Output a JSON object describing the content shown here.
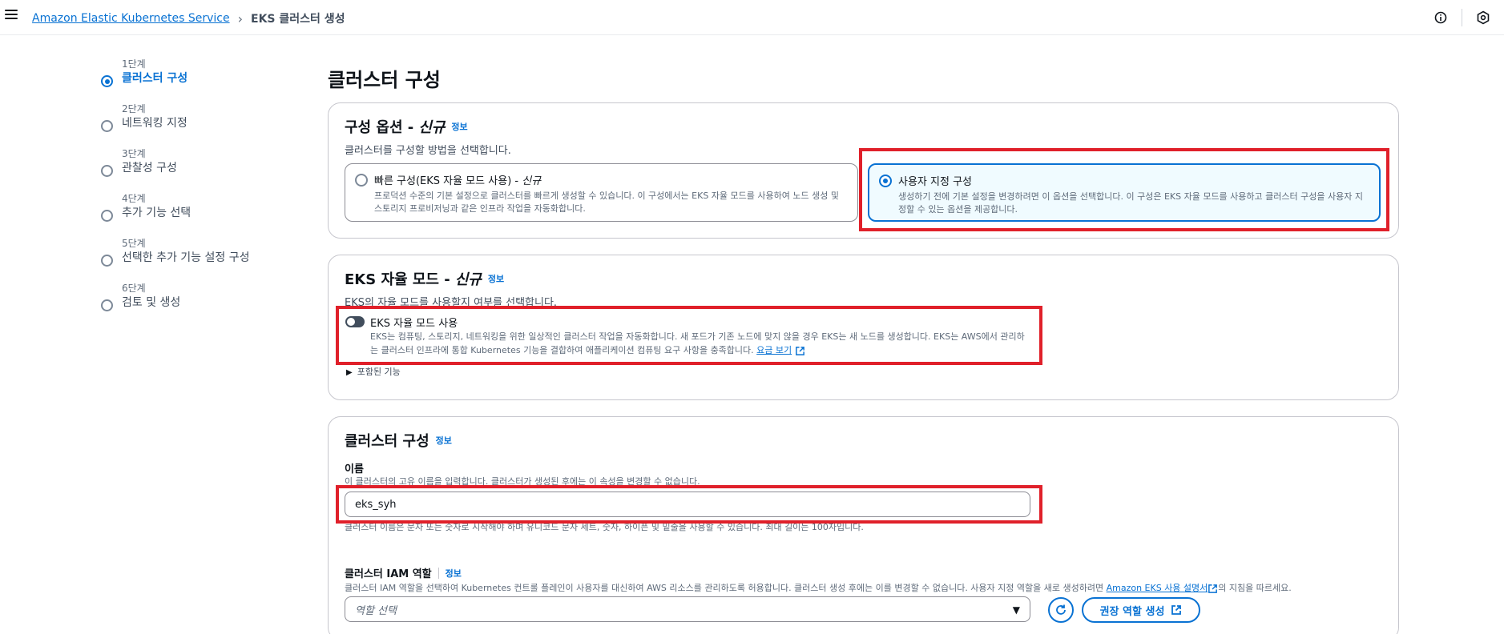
{
  "topbar": {
    "breadcrumb_service": "Amazon Elastic Kubernetes Service",
    "breadcrumb_current": "EKS 클러스터 생성"
  },
  "steps": [
    {
      "num": "1단계",
      "label": "클러스터 구성",
      "active": true
    },
    {
      "num": "2단계",
      "label": "네트워킹 지정"
    },
    {
      "num": "3단계",
      "label": "관찰성 구성"
    },
    {
      "num": "4단계",
      "label": "추가 기능 선택"
    },
    {
      "num": "5단계",
      "label": "선택한 추가 기능 설정 구성"
    },
    {
      "num": "6단계",
      "label": "검토 및 생성"
    }
  ],
  "page_title": "클러스터 구성",
  "config_options": {
    "title": "구성 옵션 - ",
    "title_em": "신규",
    "info": "정보",
    "desc": "클러스터를 구성할 방법을 선택합니다.",
    "quick": {
      "title": "빠른 구성(EKS 자율 모드 사용) - ",
      "title_em": "신규",
      "desc": "프로덕션 수준의 기본 설정으로 클러스터를 빠르게 생성할 수 있습니다. 이 구성에서는 EKS 자율 모드를 사용하여 노드 생성 및 스토리지 프로비저닝과 같은 인프라 작업을 자동화합니다."
    },
    "custom": {
      "title": "사용자 지정 구성",
      "desc": "생성하기 전에 기본 설정을 변경하려면 이 옵션을 선택합니다. 이 구성은 EKS 자율 모드를 사용하고 클러스터 구성을 사용자 지정할 수 있는 옵션을 제공합니다."
    }
  },
  "auto_mode": {
    "title": "EKS 자율 모드 - ",
    "title_em": "신규",
    "info": "정보",
    "desc": "EKS의 자율 모드를 사용할지 여부를 선택합니다.",
    "toggle_label": "EKS 자율 모드 사용",
    "toggle_on": false,
    "toggle_desc": "EKS는 컴퓨팅, 스토리지, 네트워킹을 위한 일상적인 클러스터 작업을 자동화합니다. 새 포드가 기존 노드에 맞지 않을 경우 EKS는 새 노드를 생성합니다. EKS는 AWS에서 관리하는 클러스터 인프라에 통합 Kubernetes 기능을 결합하여 애플리케이션 컴퓨팅 요구 사항을 충족합니다.",
    "pricing_link": "요금 보기",
    "included": "포함된 기능"
  },
  "cluster_config": {
    "title": "클러스터 구성",
    "info": "정보",
    "name_label": "이름",
    "name_desc": "이 클러스터의 고유 이름을 입력합니다. 클러스터가 생성된 후에는 이 속성을 변경할 수 없습니다.",
    "name_value": "eks_syh",
    "name_hint": "클러스터 이름은 문자 또는 숫자로 시작해야 하며 유니코드 문자 세트, 숫자, 하이픈 및 밑줄을 사용할 수 있습니다. 최대 길이는 100자입니다.",
    "iam_label": "클러스터 IAM 역할",
    "iam_info": "정보",
    "iam_desc": "클러스터 IAM 역할을 선택하여 Kubernetes 컨트롤 플레인이 사용자를 대신하여 AWS 리소스를 관리하도록 허용합니다. 클러스터 생성 후에는 이를 변경할 수 없습니다. 사용자 지정 역할을 새로 생성하려면 ",
    "iam_doc_link": "Amazon EKS 사용 설명서",
    "iam_desc_tail": "의 지침을 따르세요.",
    "role_placeholder": "역할 선택",
    "create_role_button": "권장 역할 생성"
  },
  "colors": {
    "accent": "#0972d3",
    "highlight": "#e0202a"
  }
}
